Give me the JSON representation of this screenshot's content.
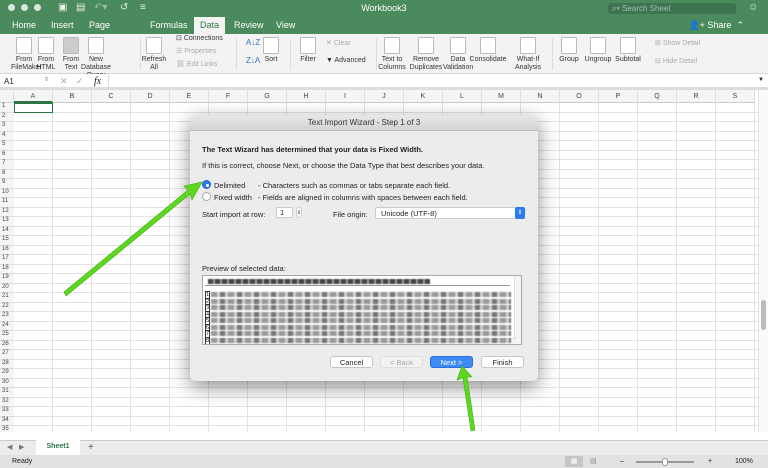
{
  "window": {
    "title": "Workbook3",
    "search_placeholder": "Search Sheet",
    "share": "Share"
  },
  "tabs": [
    "Home",
    "Insert",
    "Page Layout",
    "Formulas",
    "Data",
    "Review",
    "View"
  ],
  "active_tab": "Data",
  "ribbon": {
    "big": [
      {
        "label": "From FileMaker"
      },
      {
        "label": "From HTML"
      },
      {
        "label": "From Text"
      },
      {
        "label": "New Database Query"
      },
      {
        "label": "Refresh All"
      },
      {
        "label": "Sort"
      },
      {
        "label": "Filter"
      },
      {
        "label": "Text to Columns"
      },
      {
        "label": "Remove Duplicates"
      },
      {
        "label": "Data Validation"
      },
      {
        "label": "Consolidate"
      },
      {
        "label": "What-If Analysis"
      },
      {
        "label": "Group"
      },
      {
        "label": "Ungroup"
      },
      {
        "label": "Subtotal"
      }
    ],
    "small": {
      "connections": "Connections",
      "properties": "Properties",
      "edit_links": "Edit Links",
      "clear": "Clear",
      "advanced": "Advanced",
      "show_detail": "Show Detail",
      "hide_detail": "Hide Detail"
    }
  },
  "formula_bar": {
    "name_box": "A1",
    "fx": "fx",
    "value": ""
  },
  "columns": [
    "A",
    "B",
    "C",
    "D",
    "E",
    "F",
    "G",
    "H",
    "I",
    "J",
    "K",
    "L",
    "M",
    "N",
    "O",
    "P",
    "Q",
    "R",
    "S"
  ],
  "row_count": 35,
  "sheet_tabs": [
    "Sheet1"
  ],
  "status": {
    "text": "Ready",
    "zoom": "100%",
    "zoom_level": 0.5
  },
  "dialog": {
    "title": "Text Import Wizard - Step 1 of 3",
    "heading": "The Text Wizard has determined that your data is Fixed Width.",
    "subheading": "If this is correct, choose Next, or choose the Data Type that best describes your data.",
    "options": [
      {
        "label": "Delimited",
        "desc": "- Characters such as commas or tabs separate each field.",
        "selected": true
      },
      {
        "label": "Fixed width",
        "desc": "- Fields are aligned in columns with spaces between each field.",
        "selected": false
      }
    ],
    "start_row_label": "Start import at row:",
    "start_row": "1",
    "file_origin_label": "File origin:",
    "file_origin": "Unicode (UTF-8)",
    "preview_label": "Preview of selected data:",
    "preview_rows": [
      "1",
      "2",
      "3",
      "4",
      "5",
      "6",
      "7",
      "8"
    ],
    "buttons": {
      "cancel": "Cancel",
      "back": "< Back",
      "next": "Next >",
      "finish": "Finish"
    }
  },
  "colors": {
    "excel_green": "#4a8a5c",
    "accent_blue": "#2b7cf0",
    "arrow_green": "#5fd61f"
  }
}
